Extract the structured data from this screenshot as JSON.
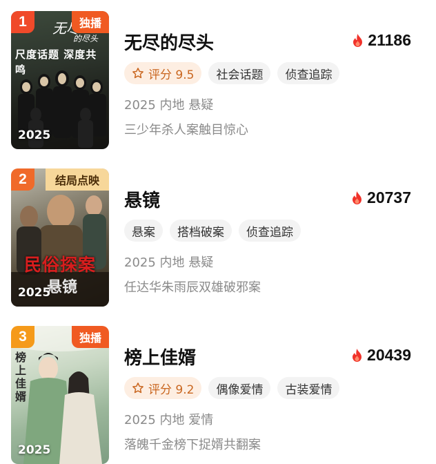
{
  "items": [
    {
      "rank": "1",
      "badge": "独播",
      "poster_year": "2025",
      "poster_text": "尺度话题 深度共鸣",
      "title": "无尽的尽头",
      "heat": "21186",
      "score": "评分 9.5",
      "tags": [
        "社会话题",
        "侦查追踪"
      ],
      "meta": "2025 内地 悬疑",
      "desc": "三少年杀人案触目惊心"
    },
    {
      "rank": "2",
      "badge": "结局点映",
      "poster_year": "2025",
      "poster_text": "民俗探案",
      "poster_logo": "悬镜",
      "title": "悬镜",
      "heat": "20737",
      "score": null,
      "tags": [
        "悬案",
        "搭档破案",
        "侦查追踪"
      ],
      "meta": "2025 内地 悬疑",
      "desc": "任达华朱雨辰双雄破邪案"
    },
    {
      "rank": "3",
      "badge": "独播",
      "poster_year": "2025",
      "poster_text": "榜上佳婿",
      "title": "榜上佳婿",
      "heat": "20439",
      "score": "评分 9.2",
      "tags": [
        "偶像爱情",
        "古装爱情"
      ],
      "meta": "2025 内地 爱情",
      "desc": "落魄千金榜下捉婿共翻案"
    }
  ],
  "colors": {
    "rank1": "#f04a2a",
    "rank2": "#f06a2a",
    "rank3": "#f59a1a",
    "flame": "#f0322a",
    "score_text": "#c9661f",
    "score_bg": "#fdeee2"
  }
}
